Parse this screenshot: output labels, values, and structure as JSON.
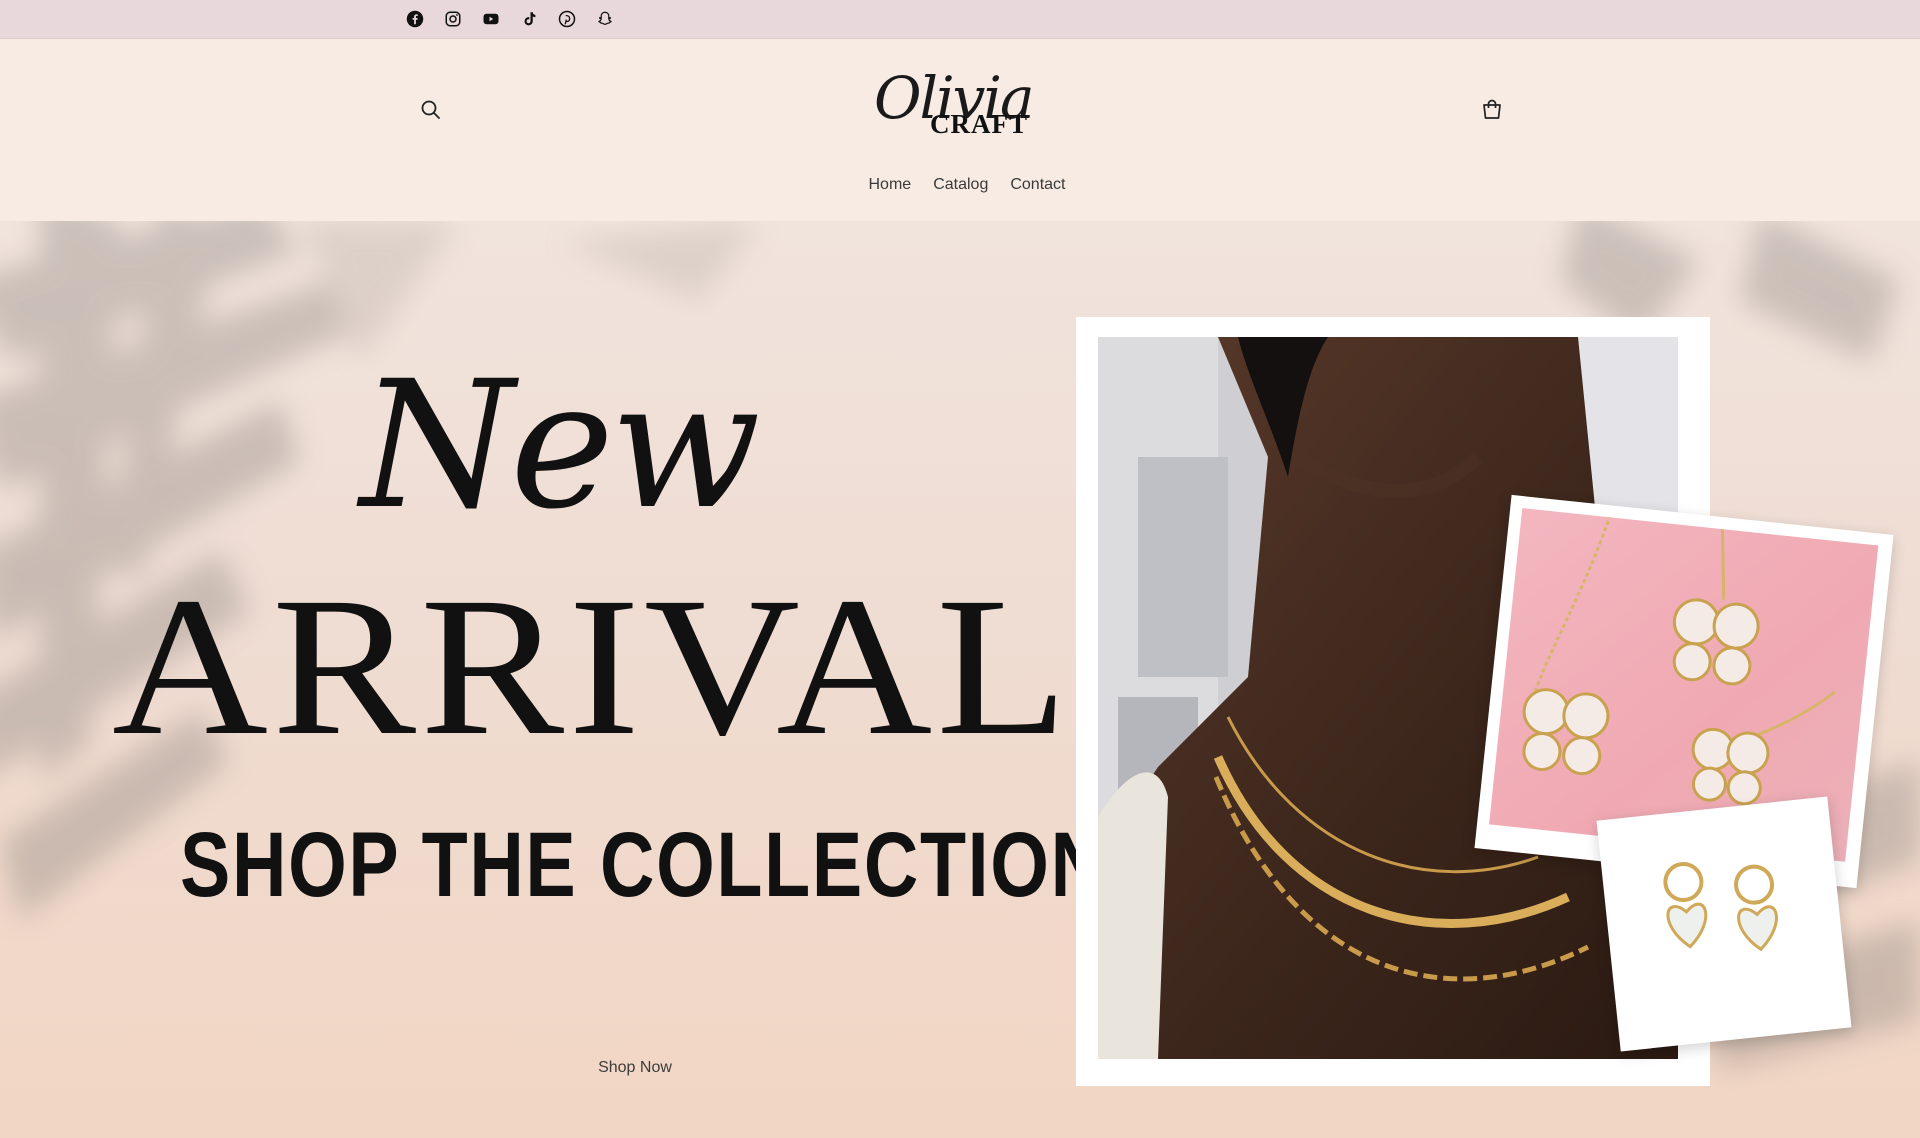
{
  "social": {
    "icons": [
      "facebook-icon",
      "instagram-icon",
      "youtube-icon",
      "tiktok-icon",
      "pinterest-icon",
      "snapchat-icon"
    ]
  },
  "header": {
    "logo_script": "Olivia",
    "logo_caps": "CRAFT",
    "search_icon": "search-icon",
    "cart_icon": "cart-icon"
  },
  "nav": {
    "items": [
      {
        "label": "Home"
      },
      {
        "label": "Catalog"
      },
      {
        "label": "Contact"
      }
    ]
  },
  "hero": {
    "headline_script": "New",
    "headline_caps": "ARRIVAL",
    "subheadline": "SHOP THE COLLECTION",
    "cta_label": "Shop Now"
  },
  "colors": {
    "announce_bar": "#e8d8dc",
    "header_bg": "#f8ebe4",
    "hero_bg": "#efdcd2",
    "text": "#111111",
    "accent_pink": "#f0a9b3"
  }
}
